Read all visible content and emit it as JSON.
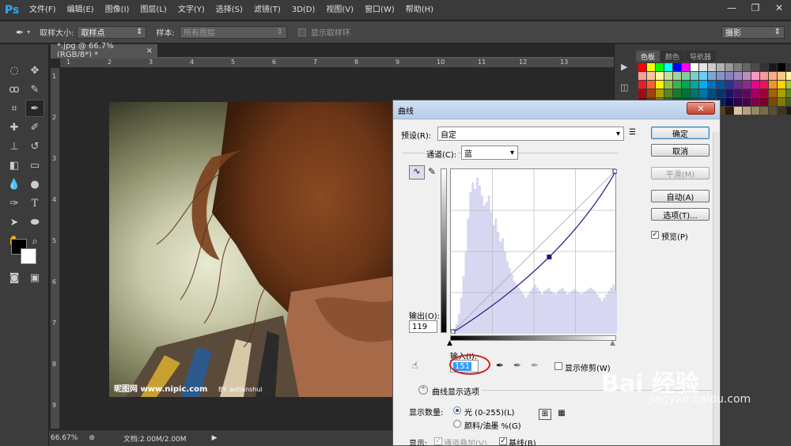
{
  "app": {
    "logo": "Ps"
  },
  "menu": [
    "文件(F)",
    "编辑(E)",
    "图像(I)",
    "图层(L)",
    "文字(Y)",
    "选择(S)",
    "滤镜(T)",
    "3D(D)",
    "视图(V)",
    "窗口(W)",
    "帮助(H)"
  ],
  "window_controls": {
    "minimize": "—",
    "restore": "❐",
    "close": "✕"
  },
  "options": {
    "sample_size_label": "取样大小:",
    "sample_size_value": "取样点",
    "sample_label": "样本:",
    "sample_value": "所有图层",
    "show_ring_label": "显示取样环",
    "workspace": "摄影"
  },
  "document": {
    "tab_title": "*.jpg @ 66.7%(RGB/8*) *",
    "tab_close": "×"
  },
  "rulers": {
    "top": [
      "1",
      "2",
      "3",
      "4",
      "5",
      "6",
      "7",
      "8",
      "9",
      "10",
      "11",
      "12",
      "13"
    ],
    "left": [
      "1",
      "2",
      "3",
      "4",
      "5",
      "6",
      "7",
      "8",
      "9"
    ]
  },
  "photo_watermark": "昵图网 www.nipic.com",
  "photo_author": "BY: aotianshui",
  "status": {
    "zoom": "66.67%",
    "doc": "文档:2.00M/2.00M"
  },
  "panel": {
    "tabs": [
      "色板",
      "颜色",
      "导航器"
    ]
  },
  "swatch_colors": [
    "#ff0000",
    "#ffff00",
    "#00ff00",
    "#00ffff",
    "#0000ff",
    "#ff00ff",
    "#ffffff",
    "#e5e5e5",
    "#cccccc",
    "#b2b2b2",
    "#999999",
    "#7f7f7f",
    "#666666",
    "#4c4c4c",
    "#333333",
    "#191919",
    "#000000",
    "#2e2e2e",
    "#f4a09a",
    "#fbc79b",
    "#fff79e",
    "#c4df9b",
    "#a3d39c",
    "#82ca9c",
    "#7bcdc8",
    "#6ecff6",
    "#7ea6d9",
    "#8493ca",
    "#8882be",
    "#a187be",
    "#bc8cbf",
    "#f49ac1",
    "#f6989d",
    "#f9ad81",
    "#fdc68a",
    "#fff699",
    "#ed1c24",
    "#f26522",
    "#fff200",
    "#8dc63f",
    "#39b54a",
    "#00a651",
    "#00a99d",
    "#00aeef",
    "#0072bc",
    "#0054a6",
    "#2e3192",
    "#662d91",
    "#92278f",
    "#ec008c",
    "#ed145b",
    "#f7941d",
    "#ffd200",
    "#a0c63a",
    "#9e0b0f",
    "#a0410d",
    "#aba000",
    "#598527",
    "#197b30",
    "#007236",
    "#00746b",
    "#0076a3",
    "#004a80",
    "#003471",
    "#1b1464",
    "#440e62",
    "#630460",
    "#9e005d",
    "#9e0039",
    "#a36209",
    "#aba000",
    "#598527",
    "#790000",
    "#7b2e00",
    "#827b00",
    "#406618",
    "#005e20",
    "#005826",
    "#005952",
    "#005b7f",
    "#003663",
    "#002157",
    "#0d004c",
    "#32004b",
    "#4b0049",
    "#7b0046",
    "#7a0026",
    "#7d4900",
    "#827b00",
    "#406618",
    "#c7b299",
    "#998675",
    "#736357",
    "#534741",
    "#37302d",
    "#c69c6e",
    "#a67c52",
    "#8c6239",
    "#754c24",
    "#603913",
    "#2a1a0e",
    "#d9c29d",
    "#b7a27e",
    "#968863",
    "#766b4b",
    "#574e32",
    "#3d361f",
    "#1f1b10"
  ],
  "curves": {
    "title": "曲线",
    "close": "✕",
    "preset_label": "预设(R):",
    "preset_value": "自定",
    "channel_label": "通道(C):",
    "channel_value": "蓝",
    "output_label": "输出(O):",
    "output_value": "119",
    "input_label": "输入(I):",
    "input_value": "151",
    "show_clipping": "显示修剪(W)",
    "display_options": "曲线显示选项",
    "show_amount_label": "显示数量:",
    "light_option": "光 (0-255)(L)",
    "pigment_option": "颜料/油墨 %(G)",
    "show_label": "显示:",
    "channel_overlay": "通道叠加(V)",
    "baseline": "基线(B)",
    "buttons": {
      "ok": "确定",
      "cancel": "取消",
      "smooth": "平滑(M)",
      "auto": "自动(A)",
      "options": "选项(T)..."
    },
    "preview_label": "预览(P)",
    "preset_icon": "☰",
    "curve_points": [
      [
        0,
        0
      ],
      [
        151,
        119
      ],
      [
        255,
        255
      ]
    ],
    "histogram": [
      2,
      3,
      6,
      12,
      22,
      35,
      50,
      70,
      86,
      92,
      88,
      95,
      90,
      84,
      78,
      80,
      84,
      74,
      66,
      70,
      62,
      56,
      58,
      50,
      44,
      40,
      36,
      32,
      30,
      28,
      26,
      24,
      22,
      24,
      26,
      28,
      30,
      28,
      26,
      24,
      26,
      27,
      28,
      26,
      25,
      24,
      26,
      27,
      28,
      26,
      24,
      25,
      26,
      27,
      26,
      25,
      24,
      25,
      26,
      27,
      28,
      27,
      26,
      24,
      22,
      20,
      22,
      24,
      26,
      28,
      30,
      26
    ]
  },
  "baidu": {
    "logo": "Bai  经验",
    "url": "jingyan.baidu.com"
  }
}
